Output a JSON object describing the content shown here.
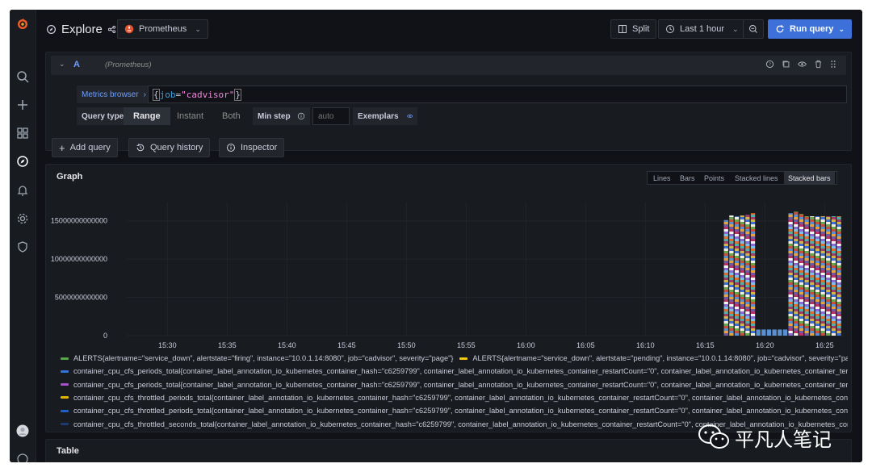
{
  "topbar": {
    "title": "Explore",
    "datasource": "Prometheus",
    "split_label": "Split",
    "time_range": "Last 1 hour",
    "run_label": "Run query"
  },
  "query": {
    "ref_id": "A",
    "datasource_hint": "(Prometheus)",
    "metrics_browser": "Metrics browser",
    "expr_open": "{",
    "expr_key": "job",
    "expr_eq": "=",
    "expr_value": "\"cadvisor\"",
    "expr_close": "}",
    "query_type_label": "Query type",
    "types": [
      "Range",
      "Instant",
      "Both"
    ],
    "min_step_label": "Min step",
    "min_step_placeholder": "auto",
    "exemplars_label": "Exemplars"
  },
  "actions": {
    "add_query": "Add query",
    "history": "Query history",
    "inspector": "Inspector"
  },
  "graph": {
    "title": "Graph",
    "modes": [
      "Lines",
      "Bars",
      "Points",
      "Stacked lines",
      "Stacked bars"
    ],
    "active_mode": "Stacked bars"
  },
  "chart_data": {
    "type": "bar",
    "stacked": true,
    "y_ticks": [
      "0",
      "5000000000000",
      "10000000000000",
      "15000000000000"
    ],
    "x_ticks": [
      "15:30",
      "15:35",
      "15:40",
      "15:45",
      "15:50",
      "15:55",
      "16:00",
      "16:05",
      "16:10",
      "16:15",
      "16:20",
      "16:25"
    ],
    "ylim": [
      0,
      17500000000000
    ],
    "x_domain_minutes": [
      26.6,
      86.6
    ],
    "legend": [
      {
        "color": "#56a64b",
        "label": "ALERTS{alertname=\"service_down\", alertstate=\"firing\", instance=\"10.0.1.14:8080\", job=\"cadvisor\", severity=\"page\"}"
      },
      {
        "color": "#f2cc0c",
        "label": "ALERTS{alertname=\"service_down\", alertstate=\"pending\", instance=\"10.0.1.14:8080\", job=\"cadvisor\", severity=\"page\"}"
      },
      {
        "color": "#5794f2",
        "label": ""
      },
      {
        "color": "#3274d9",
        "label": "container_cpu_cfs_periods_total{container_label_annotation_io_kubernetes_container_hash=\"c6259799\", container_label_annotation_io_kubernetes_container_restartCount=\"0\", container_label_annotation_io_kubernetes_container_terminati"
      },
      {
        "color": "#a352cc",
        "label": "container_cpu_cfs_periods_total{container_label_annotation_io_kubernetes_container_hash=\"c6259799\", container_label_annotation_io_kubernetes_container_restartCount=\"0\", container_label_annotation_io_kubernetes_container_terminati"
      },
      {
        "color": "#e0b400",
        "label": "container_cpu_cfs_throttled_periods_total{container_label_annotation_io_kubernetes_container_hash=\"c6259799\", container_label_annotation_io_kubernetes_container_restartCount=\"0\", container_label_annotation_io_kubernetes_container_terminati"
      },
      {
        "color": "#1f60c4",
        "label": "container_cpu_cfs_throttled_periods_total{container_label_annotation_io_kubernetes_container_hash=\"c6259799\", container_label_annotation_io_kubernetes_container_restartCount=\"0\", container_label_annotation_io_kubernetes_container_"
      },
      {
        "color": "#1f3a73",
        "label": "container_cpu_cfs_throttled_seconds_total{container_label_annotation_io_kubernetes_container_hash=\"c6259799\", container_label_annotation_io_kubernetes_container_restartCount=\"0\", container_label_annotation_io_kubernetes_containe"
      }
    ],
    "segment_colors": [
      "#6f5aa3",
      "#e8a33e",
      "#5a8fd0",
      "#c9503e",
      "#6aa54c",
      "#f0ede0",
      "#3f6fd1",
      "#d4b54b",
      "#a03c6a",
      "#53b0a8",
      "#e06d2f",
      "#7ec0e8",
      "#8c6ad6",
      "#f4f4f4",
      "#b8326a"
    ],
    "bars": [
      {
        "t": 76.75,
        "value": 15100000000000
      },
      {
        "t": 77.2,
        "value": 15700000000000
      },
      {
        "t": 77.65,
        "value": 15600000000000
      },
      {
        "t": 78.1,
        "value": 15700000000000
      },
      {
        "t": 78.55,
        "value": 15800000000000
      },
      {
        "t": 79.0,
        "value": 16000000000000
      },
      {
        "t": 79.45,
        "value": 800000000000
      },
      {
        "t": 79.9,
        "value": 800000000000
      },
      {
        "t": 80.35,
        "value": 800000000000
      },
      {
        "t": 80.8,
        "value": 800000000000
      },
      {
        "t": 81.25,
        "value": 800000000000
      },
      {
        "t": 81.7,
        "value": 800000000000
      },
      {
        "t": 82.15,
        "value": 16000000000000
      },
      {
        "t": 82.6,
        "value": 16200000000000
      },
      {
        "t": 83.05,
        "value": 15900000000000
      },
      {
        "t": 83.5,
        "value": 15600000000000
      },
      {
        "t": 83.95,
        "value": 15600000000000
      },
      {
        "t": 84.4,
        "value": 15600000000000
      },
      {
        "t": 84.85,
        "value": 15600000000000
      },
      {
        "t": 85.3,
        "value": 15600000000000
      },
      {
        "t": 85.75,
        "value": 15600000000000
      },
      {
        "t": 86.2,
        "value": 15600000000000
      }
    ]
  },
  "table": {
    "title": "Table"
  },
  "watermark": {
    "text": "平凡人笔记"
  }
}
